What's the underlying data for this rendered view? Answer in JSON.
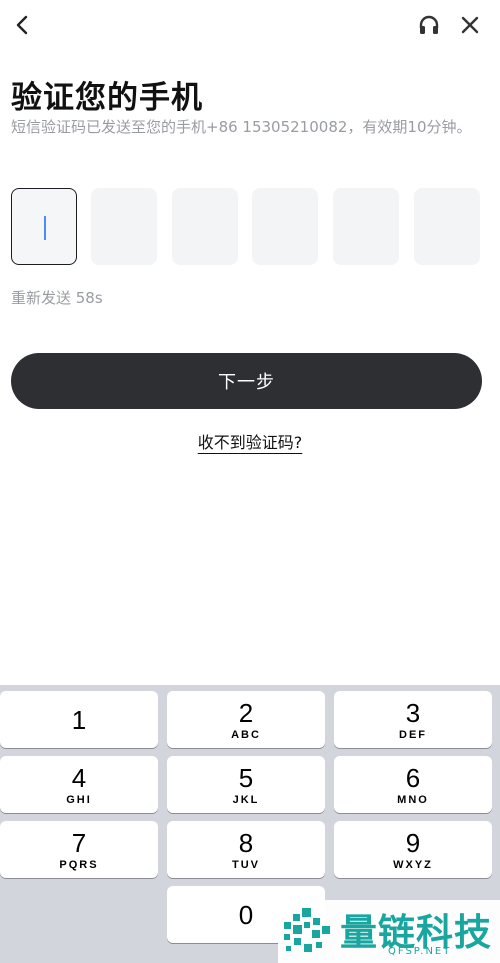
{
  "header": {
    "back_icon": "chevron-left-icon",
    "support_icon": "headset-icon",
    "close_icon": "close-icon"
  },
  "page": {
    "title": "验证您的手机",
    "description": "短信验证码已发送至您的手机+86 15305210082，有效期10分钟。"
  },
  "code_input": {
    "length": 6,
    "values": [
      "",
      "",
      "",
      "",
      "",
      ""
    ],
    "active_index": 0,
    "caret_color": "#4a8cff"
  },
  "resend": {
    "label": "重新发送 58s"
  },
  "next_button": {
    "label": "下一步",
    "color": "#2d2f33"
  },
  "help_link": {
    "label": "收不到验证码?"
  },
  "keyboard": {
    "keys": [
      {
        "digit": "1",
        "letters": ""
      },
      {
        "digit": "2",
        "letters": "ABC"
      },
      {
        "digit": "3",
        "letters": "DEF"
      },
      {
        "digit": "4",
        "letters": "GHI"
      },
      {
        "digit": "5",
        "letters": "JKL"
      },
      {
        "digit": "6",
        "letters": "MNO"
      },
      {
        "digit": "7",
        "letters": "PQRS"
      },
      {
        "digit": "8",
        "letters": "TUV"
      },
      {
        "digit": "9",
        "letters": "WXYZ"
      },
      {
        "digit": "0",
        "letters": ""
      }
    ]
  },
  "watermark": {
    "name": "量链科技",
    "site": "QFSP.NET",
    "color": "#1aa6a0"
  }
}
